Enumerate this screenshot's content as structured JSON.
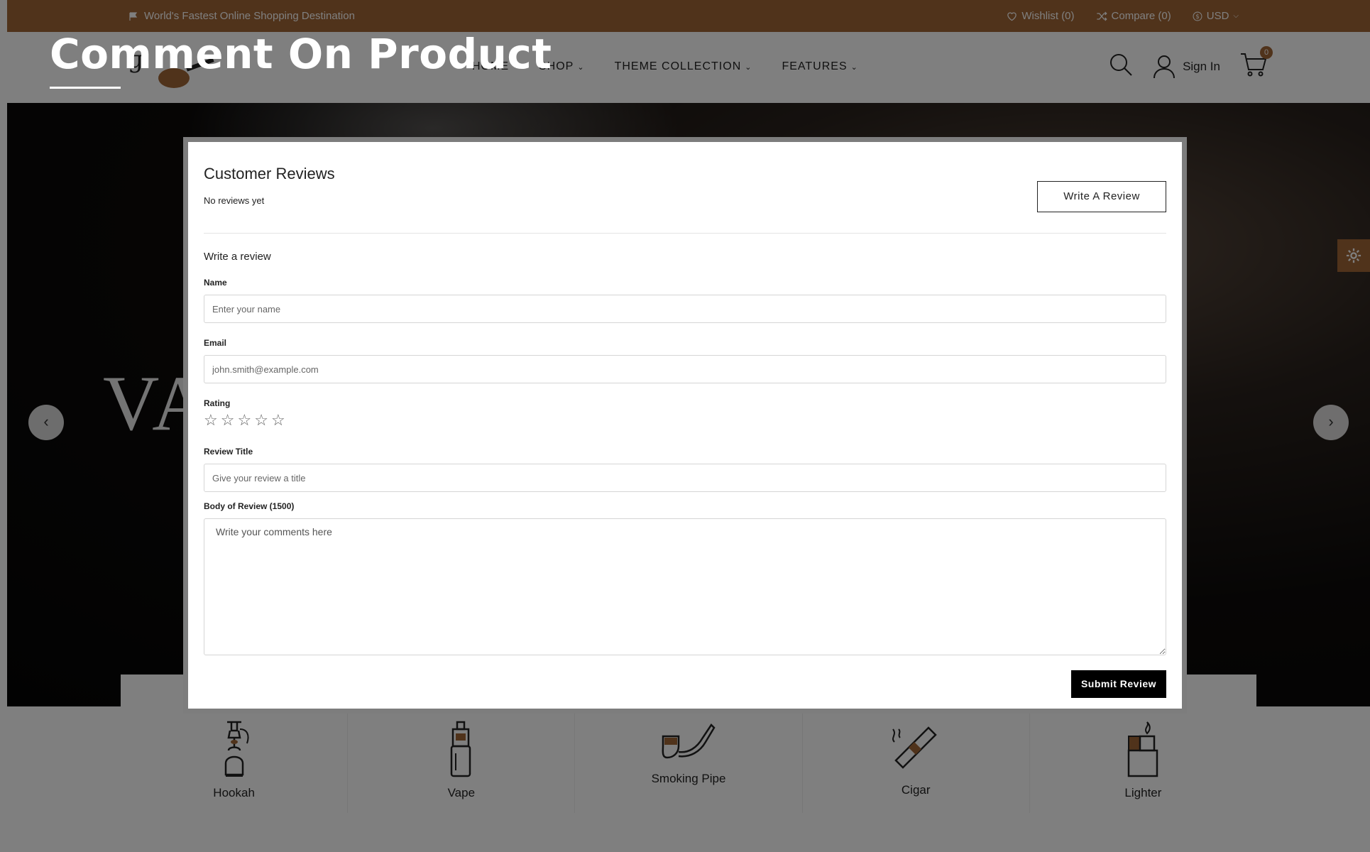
{
  "topbar": {
    "promo": "World's Fastest Online Shopping Destination",
    "wishlist": "Wishlist (0)",
    "compare": "Compare (0)",
    "currency": "USD"
  },
  "header": {
    "nav": [
      {
        "label": "HOME"
      },
      {
        "label": "SHOP"
      },
      {
        "label": "THEME COLLECTION"
      },
      {
        "label": "FEATURES"
      }
    ],
    "signin": "Sign In",
    "cart_count": "0"
  },
  "hero": {
    "title": "VA"
  },
  "categories": [
    {
      "label": "Hookah",
      "icon": "hookah-icon"
    },
    {
      "label": "Vape",
      "icon": "vape-icon"
    },
    {
      "label": "Smoking Pipe",
      "icon": "smoking-pipe-icon"
    },
    {
      "label": "Cigar",
      "icon": "cigar-icon"
    },
    {
      "label": "Lighter",
      "icon": "lighter-icon"
    }
  ],
  "overlay": {
    "title": "Comment On Product"
  },
  "modal": {
    "heading": "Customer Reviews",
    "no_reviews": "No reviews yet",
    "write_review_button": "Write A Review",
    "write_heading": "Write a review",
    "name_label": "Name",
    "name_placeholder": "Enter your name",
    "email_label": "Email",
    "email_placeholder": "john.smith@example.com",
    "rating_label": "Rating",
    "rating_max": 5,
    "rating_value": 0,
    "title_label": "Review Title",
    "title_placeholder": "Give your review a title",
    "body_label": "Body of Review (1500)",
    "body_placeholder": "Write your comments here",
    "submit_button": "Submit Review"
  },
  "colors": {
    "brand": "#a16636",
    "overlay": "rgba(0,0,0,0.5)",
    "modal_border": "#7d7d7d"
  }
}
